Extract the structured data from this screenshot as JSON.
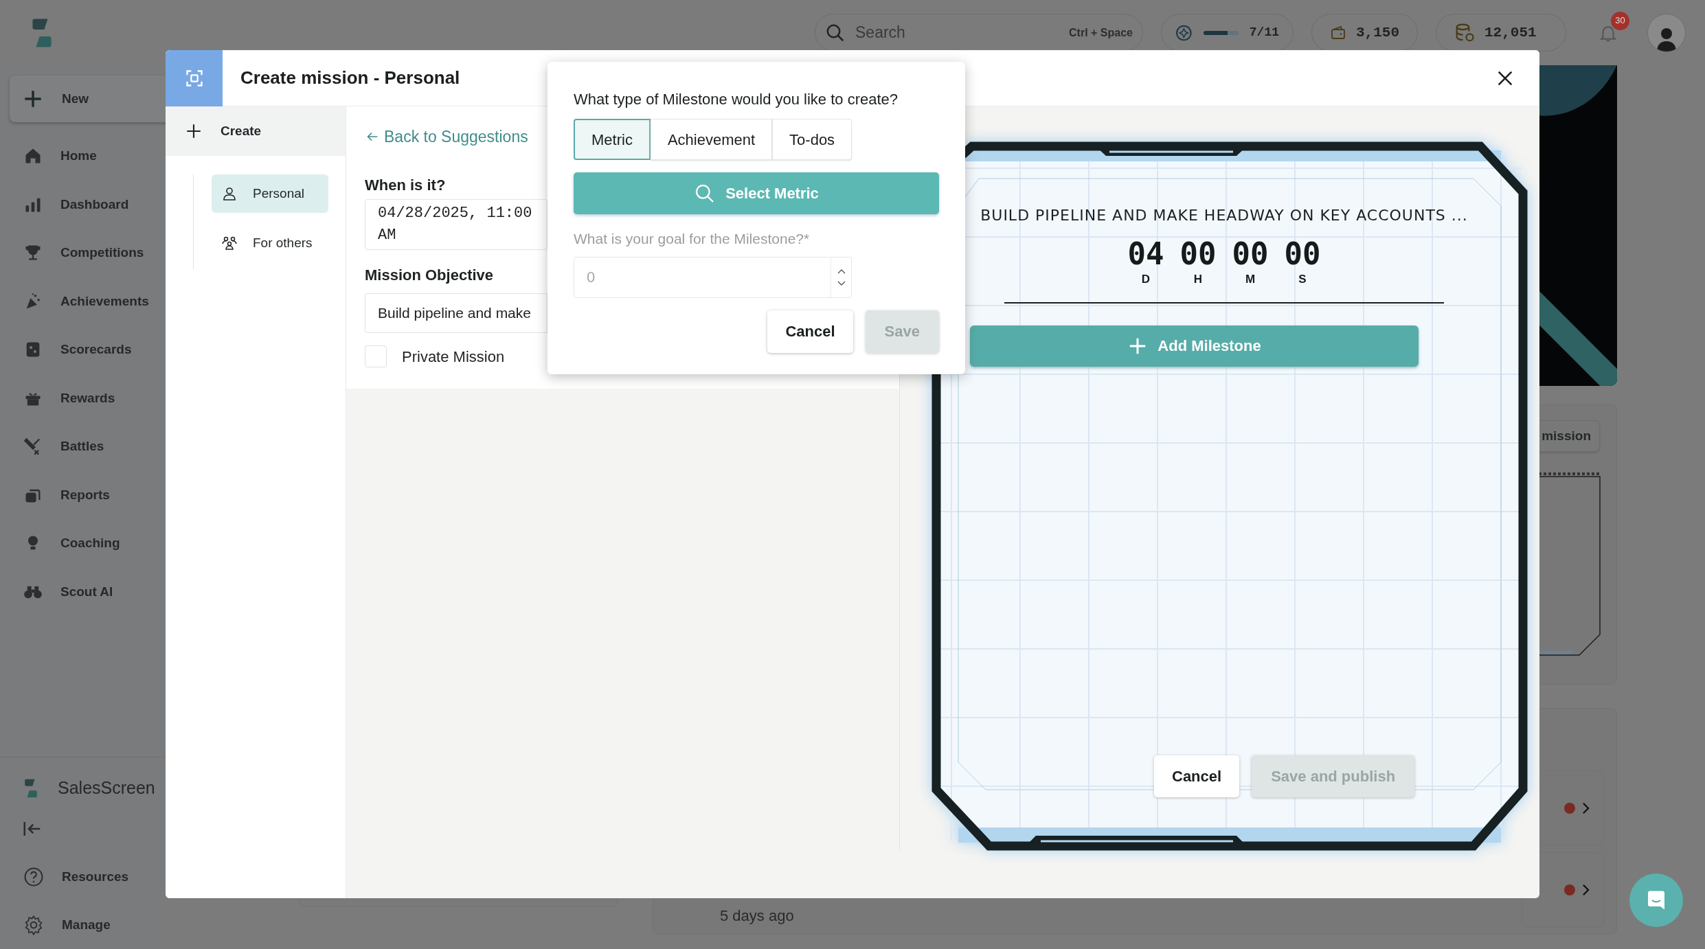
{
  "topbar": {
    "search": {
      "placeholder": "Search",
      "shortcut": "Ctrl + Space"
    },
    "progress": {
      "level": 0.7,
      "reading": "7/11"
    },
    "wallet": "3,150",
    "coins": "12,051",
    "notifications": "30"
  },
  "sidebar": {
    "new_button": "New",
    "items": [
      "Home",
      "Dashboard",
      "Competitions",
      "Achievements",
      "Scorecards",
      "Rewards",
      "Battles",
      "Reports",
      "Coaching",
      "Scout AI"
    ],
    "brand": "SalesScreen",
    "bottom_items": [
      "Resources",
      "Manage"
    ]
  },
  "background": {
    "card_button": "mission",
    "feed_time": "5 days ago",
    "feed_rows": [
      {
        "color": "#7a2a22"
      },
      {
        "color": "#7a2a22"
      }
    ]
  },
  "modal": {
    "title": "Create mission - Personal",
    "nav": {
      "create": "Create",
      "items": [
        {
          "label": "Personal",
          "selected": true
        },
        {
          "label": "For others",
          "selected": false
        }
      ]
    },
    "form": {
      "back_link": "Back to Suggestions",
      "when_label": "When is it?",
      "date_value": "04/28/2025, 11:00 AM",
      "objective_label": "Mission Objective",
      "objective_value": "Build pipeline and make",
      "private": {
        "label": "Private Mission",
        "checked": false
      }
    },
    "card": {
      "title": "BUILD PIPELINE AND MAKE HEADWAY ON KEY ACCOUNTS ...",
      "countdown": [
        {
          "value": "04",
          "unit": "D"
        },
        {
          "value": "00",
          "unit": "H"
        },
        {
          "value": "00",
          "unit": "M"
        },
        {
          "value": "00",
          "unit": "S"
        }
      ],
      "add_button": "Add Milestone",
      "cancel": "Cancel",
      "publish": {
        "label": "Save and publish",
        "disabled": true
      }
    }
  },
  "popover": {
    "question": "What type of Milestone would you like to create?",
    "tabs": [
      {
        "label": "Metric",
        "selected": true
      },
      {
        "label": "Achievement",
        "selected": false
      },
      {
        "label": "To-dos",
        "selected": false
      }
    ],
    "select_button": "Select Metric",
    "goal_label": "What is your goal for the Milestone?*",
    "goal_placeholder": "0",
    "cancel": "Cancel",
    "save": {
      "label": "Save",
      "disabled": true
    }
  }
}
